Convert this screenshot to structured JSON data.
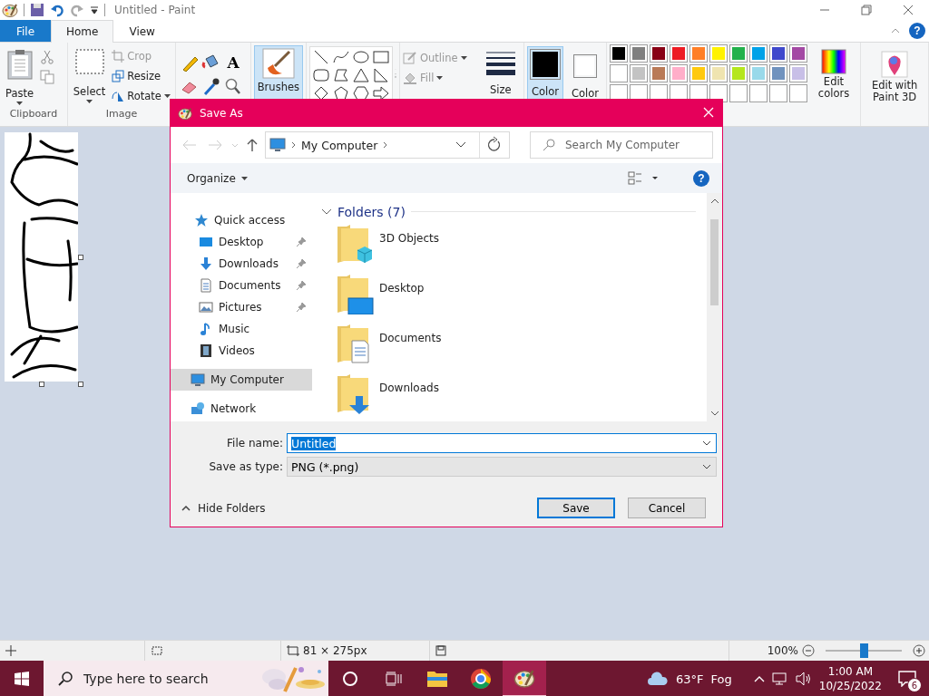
{
  "window": {
    "title": "Untitled - Paint"
  },
  "ribbon_tabs": [
    {
      "label": "File",
      "kind": "file",
      "selected": false
    },
    {
      "label": "Home",
      "kind": "tab",
      "selected": true
    },
    {
      "label": "View",
      "kind": "tab",
      "selected": false
    }
  ],
  "ribbon_help": "?",
  "ribbon": {
    "paste": "Paste",
    "clipboard_group": "Clipboard",
    "select": "Select",
    "image_tools": [
      {
        "label": "Crop",
        "kind": "crop",
        "disabled": true
      },
      {
        "label": "Resize",
        "kind": "resize",
        "disabled": false
      },
      {
        "label": "Rotate",
        "kind": "rotate",
        "disabled": false
      }
    ],
    "image_group": "Image",
    "text_tool": "A",
    "brushes": "Brushes",
    "outline": {
      "label": "Outline",
      "disabled": true
    },
    "fill": {
      "label": "Fill",
      "disabled": true
    },
    "size": "Size",
    "current_colors": [
      {
        "label": "Color",
        "color": "#000000",
        "selected": true
      },
      {
        "label": "Color",
        "color": "#ffffff",
        "selected": false
      }
    ],
    "palette": [
      {
        "color": "#000000"
      },
      {
        "color": "#7f7f7f"
      },
      {
        "color": "#880015"
      },
      {
        "color": "#ed1c24"
      },
      {
        "color": "#ff7f27"
      },
      {
        "color": "#fff200"
      },
      {
        "color": "#22b14c"
      },
      {
        "color": "#00a2e8"
      },
      {
        "color": "#3f48cc"
      },
      {
        "color": "#a349a4"
      },
      {
        "color": "#ffffff"
      },
      {
        "color": "#c3c3c3"
      },
      {
        "color": "#b97a57"
      },
      {
        "color": "#ffaec9"
      },
      {
        "color": "#ffc90e"
      },
      {
        "color": "#efe4b0"
      },
      {
        "color": "#b5e61d"
      },
      {
        "color": "#99d9ea"
      },
      {
        "color": "#7092be"
      },
      {
        "color": "#c8bfe7"
      }
    ],
    "edit_colors": "Edit colors",
    "paint3d": "Edit with Paint 3D"
  },
  "dialog": {
    "title": "Save As",
    "address": "My Computer",
    "search": {
      "placeholder": "Search My Computer"
    },
    "organize": "Organize",
    "help": "?",
    "nav": [
      {
        "label": "Quick access",
        "kind": "star",
        "selected": false,
        "children": [
          {
            "label": "Desktop",
            "kind": "desktop",
            "pinned": true,
            "selected": false
          },
          {
            "label": "Downloads",
            "kind": "download",
            "pinned": true,
            "selected": false
          },
          {
            "label": "Documents",
            "kind": "document",
            "pinned": true,
            "selected": false
          },
          {
            "label": "Pictures",
            "kind": "picture",
            "pinned": true,
            "selected": false
          },
          {
            "label": "Music",
            "kind": "music",
            "pinned": false,
            "selected": false
          },
          {
            "label": "Videos",
            "kind": "video",
            "pinned": false,
            "selected": false
          }
        ]
      },
      {
        "label": "My Computer",
        "kind": "computer",
        "selected": true
      },
      {
        "label": "Network",
        "kind": "network",
        "selected": false
      }
    ],
    "folders_header": "Folders (7)",
    "folders": [
      {
        "name": "3D Objects",
        "kind": "cube",
        "selected": false
      },
      {
        "name": "Desktop",
        "kind": "desktop",
        "selected": false
      },
      {
        "name": "Documents",
        "kind": "document",
        "selected": false
      },
      {
        "name": "Downloads",
        "kind": "download",
        "selected": false
      }
    ],
    "file_name_label": "File name:",
    "file_name": "Untitled",
    "type_label": "Save as type:",
    "type": "PNG (*.png)",
    "hide_folders": "Hide Folders",
    "buttons": [
      "Save",
      "Cancel"
    ]
  },
  "status_bar": {
    "size": "81 × 275px",
    "zoom": "100%",
    "level": 0.5
  },
  "taskbar": {
    "search": {
      "placeholder": "Type here to search"
    },
    "apps": [
      {
        "kind": "explorer",
        "active": false
      },
      {
        "kind": "chrome",
        "active": false
      },
      {
        "kind": "paint",
        "active": true
      }
    ],
    "temperature": "63°F",
    "weather": "Fog",
    "time": "1:00 AM",
    "date": "10/25/2022",
    "notifications": "6"
  }
}
